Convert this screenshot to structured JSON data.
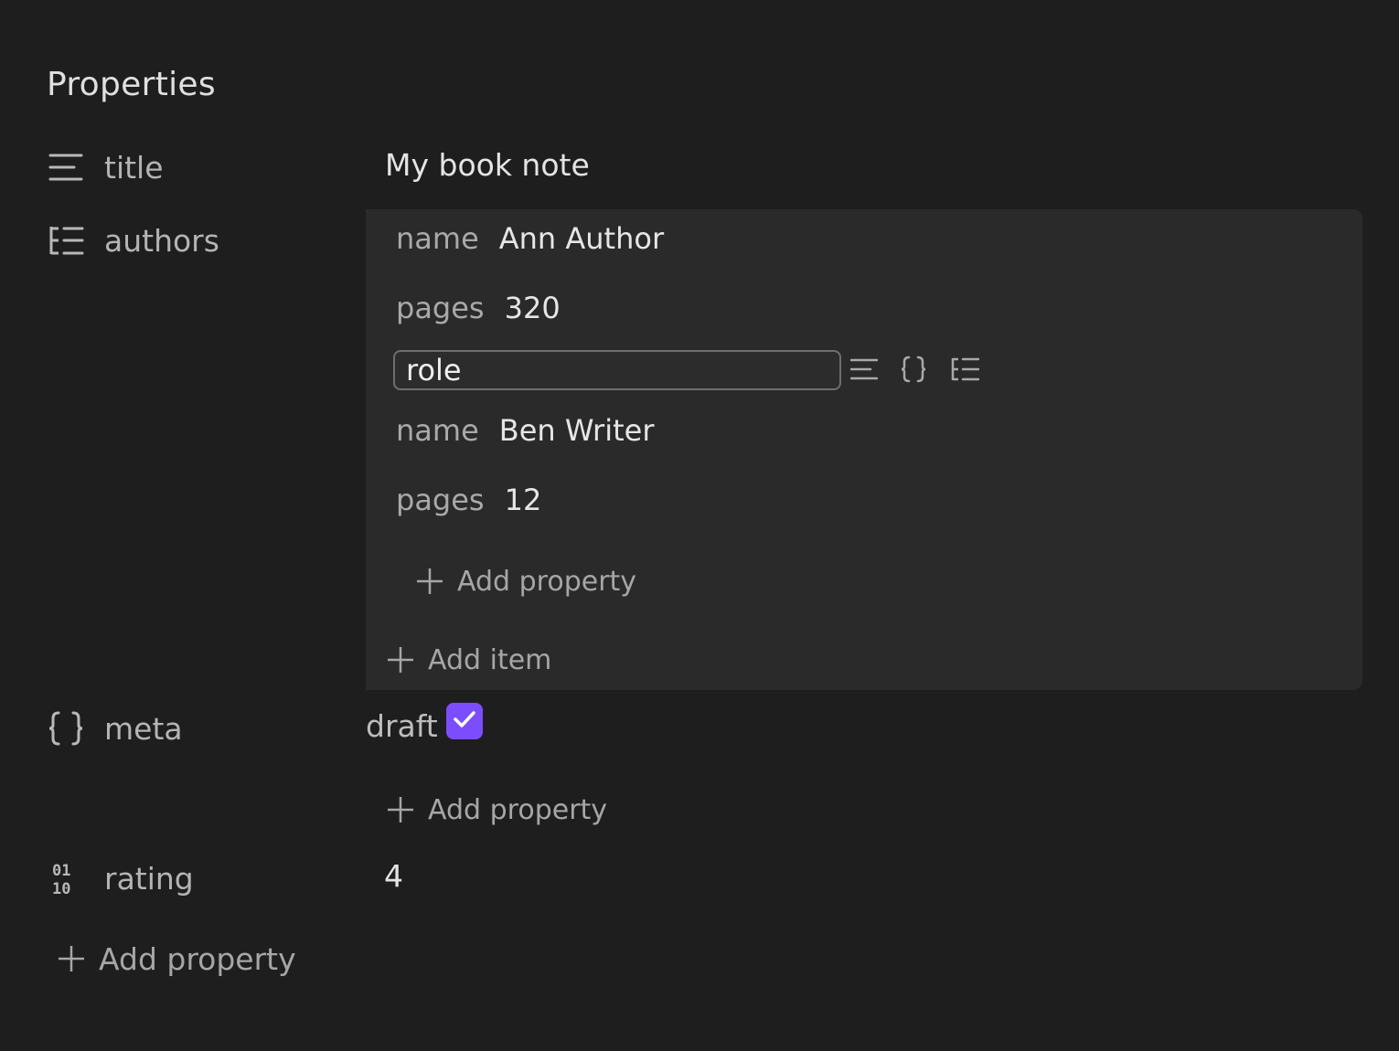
{
  "panel": {
    "heading": "Properties"
  },
  "properties": {
    "title": {
      "key": "title",
      "value": "My book note",
      "icon": "text-lines-icon"
    },
    "authors": {
      "key": "authors",
      "icon": "list-tree-icon",
      "items": [
        {
          "fields": [
            {
              "key": "name",
              "value": "Ann Author"
            },
            {
              "key": "pages",
              "value": "320"
            }
          ],
          "new_key_input": {
            "value": "role"
          }
        },
        {
          "fields": [
            {
              "key": "name",
              "value": "Ben Writer"
            },
            {
              "key": "pages",
              "value": "12"
            }
          ]
        }
      ],
      "add_property_label": "Add property",
      "add_item_label": "Add item"
    },
    "meta": {
      "key": "meta",
      "icon": "braces-icon",
      "fields": [
        {
          "key": "draft",
          "checked": true
        }
      ],
      "add_property_label": "Add property"
    },
    "rating": {
      "key": "rating",
      "value": "4",
      "icon": "binary-number-icon"
    }
  },
  "footer": {
    "add_property_label": "Add property"
  },
  "type_picker": {
    "options": [
      "text-lines-icon",
      "braces-icon",
      "list-tree-icon"
    ]
  },
  "colors": {
    "background": "#1e1e1e",
    "nested_panel": "#2a2a2a",
    "accent": "#7c4dff"
  }
}
